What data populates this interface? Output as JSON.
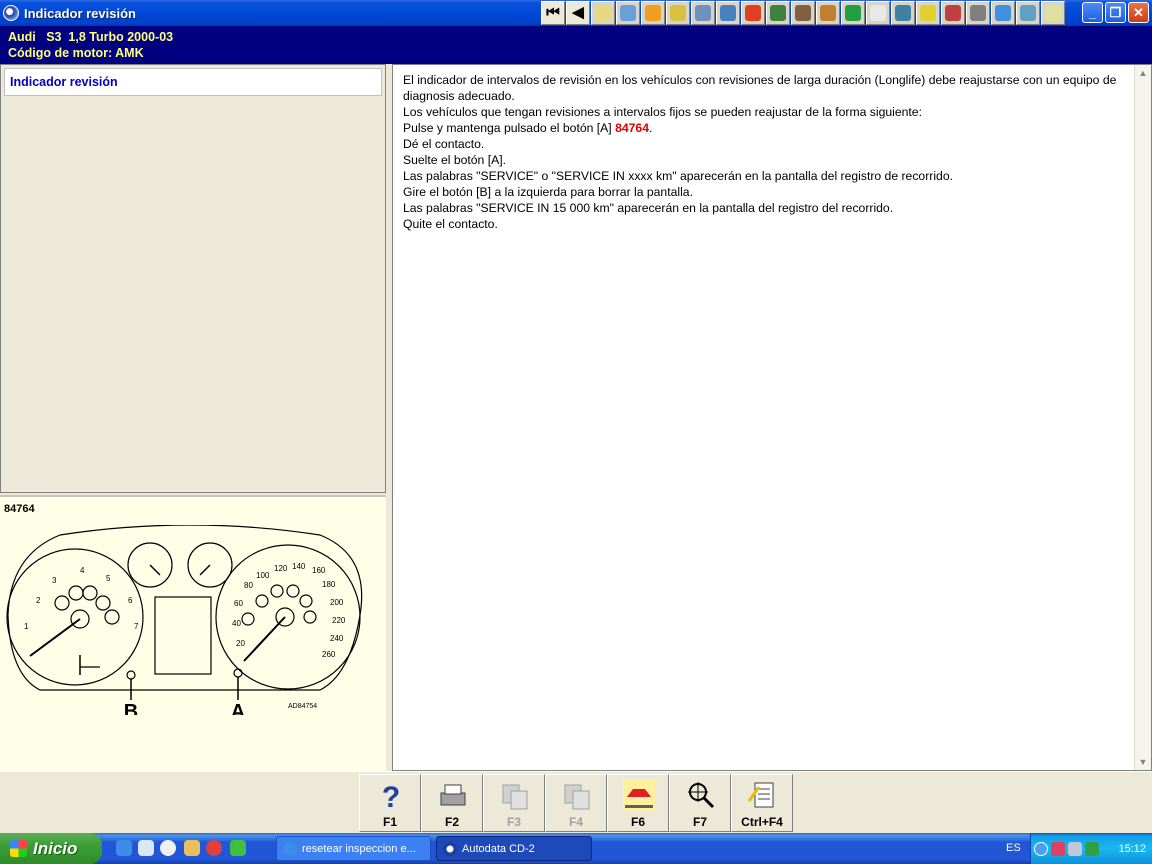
{
  "window": {
    "title": "Indicador revisión"
  },
  "vehicle": {
    "line1": "Audi   S3  1,8 Turbo 2000-03",
    "line2": "Código de motor: AMK"
  },
  "sidebar": {
    "items": [
      {
        "label": "Indicador revisión",
        "selected": true
      }
    ]
  },
  "image": {
    "reference": "84764",
    "labels": {
      "a": "A",
      "b": "B",
      "code": "AD84754"
    }
  },
  "gauge_labels": {
    "tacho": [
      "1",
      "2",
      "3",
      "4",
      "5",
      "6",
      "7"
    ],
    "speedo": [
      "20",
      "40",
      "60",
      "80",
      "100",
      "120",
      "140",
      "160",
      "180",
      "200",
      "220",
      "240",
      "260"
    ]
  },
  "content": {
    "p1": "El indicador de intervalos de revisión en los vehículos con revisiones de larga duración (Longlife) debe reajustarse con un equipo de diagnosis adecuado.",
    "p2": "Los vehículos que tengan revisiones a intervalos fijos se pueden reajustar de la forma siguiente:",
    "p3_prefix": "Pulse y mantenga pulsado el botón [A] ",
    "p3_link": "84764",
    "p3_suffix": ".",
    "p4": "Dé el contacto.",
    "p5": "Suelte el botón [A].",
    "p6": "Las palabras \"SERVICE\" o \"SERVICE IN xxxx km\" aparecerán en la pantalla del registro de recorrido.",
    "p7": "Gire el botón [B] a la izquierda para borrar la pantalla.",
    "p8": "Las palabras \"SERVICE IN 15 000 km\" aparecerán en la pantalla del registro del recorrido.",
    "p9": "Quite el contacto."
  },
  "toolbar": {
    "icons": [
      "first-page-icon",
      "previous-page-icon",
      "warning-icon",
      "engine-data-icon",
      "ignition-icon",
      "fuel-icon",
      "timing-icon",
      "tools-icon",
      "battery-icon",
      "service-icon",
      "lift-icon",
      "wiring-icon",
      "diagnostics-icon",
      "printer-icon",
      "adjustments-icon",
      "help-icon",
      "brakes-icon",
      "wheel-icon",
      "ac-icon",
      "transmission-icon",
      "notes-icon"
    ]
  },
  "fkeys": [
    {
      "label": "F1",
      "icon": "help-question-icon",
      "enabled": true
    },
    {
      "label": "F2",
      "icon": "printer-icon",
      "enabled": true
    },
    {
      "label": "F3",
      "icon": "copy-icon",
      "enabled": false
    },
    {
      "label": "F4",
      "icon": "image-icon",
      "enabled": false
    },
    {
      "label": "F6",
      "icon": "car-lift-icon",
      "enabled": true
    },
    {
      "label": "F7",
      "icon": "zoom-icon",
      "enabled": true
    },
    {
      "label": "Ctrl+F4",
      "icon": "notes-icon",
      "enabled": true
    }
  ],
  "taskbar": {
    "start": "Inicio",
    "tasks": [
      {
        "label": "resetear inspeccion e...",
        "active": false
      },
      {
        "label": "Autodata CD-2",
        "active": true
      }
    ],
    "language": "ES",
    "clock": "15:12"
  },
  "colors": {
    "title_bar": "#0047d6",
    "vehicle_bar": "#000080",
    "vehicle_text": "#ffff80",
    "link": "#e00000",
    "sidebar_item": "#0000c0"
  }
}
